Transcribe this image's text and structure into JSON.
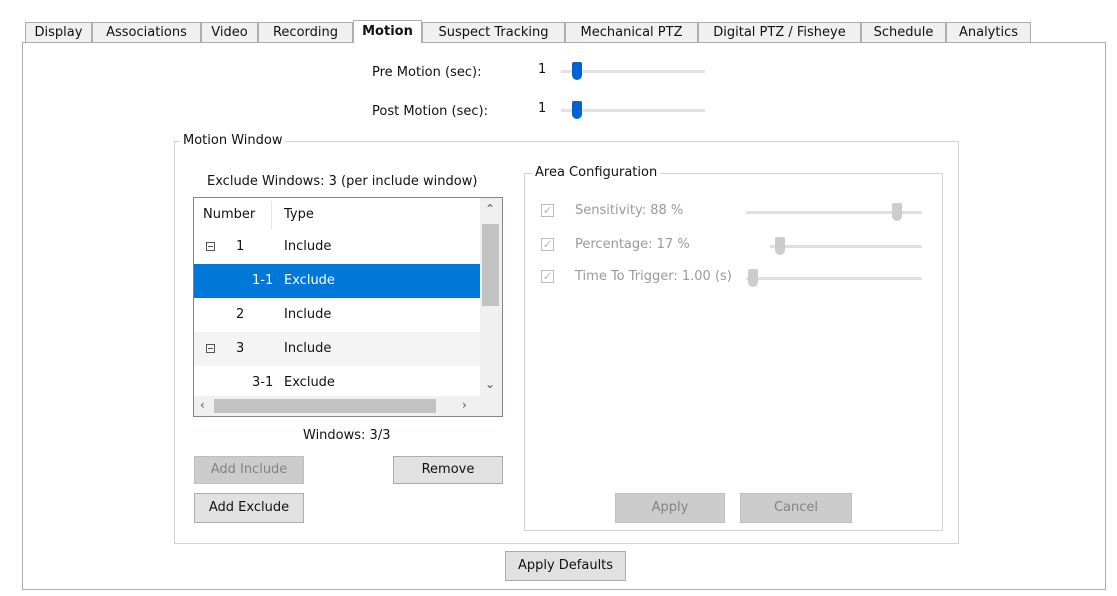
{
  "tabs": [
    {
      "label": "Display",
      "active": false
    },
    {
      "label": "Associations",
      "active": false
    },
    {
      "label": "Video",
      "active": false
    },
    {
      "label": "Recording",
      "active": false
    },
    {
      "label": "Motion",
      "active": true
    },
    {
      "label": "Suspect Tracking",
      "active": false
    },
    {
      "label": "Mechanical PTZ",
      "active": false
    },
    {
      "label": "Digital PTZ / Fisheye",
      "active": false
    },
    {
      "label": "Schedule",
      "active": false
    },
    {
      "label": "Analytics",
      "active": false
    }
  ],
  "pre_motion": {
    "label": "Pre Motion (sec):",
    "value": "1"
  },
  "post_motion": {
    "label": "Post Motion (sec):",
    "value": "1"
  },
  "motion_window": {
    "title": "Motion Window",
    "exclude_windows_text": "Exclude Windows: 3 (per include window)",
    "columns": {
      "number": "Number",
      "type": "Type"
    },
    "rows": [
      {
        "number": "1",
        "type": "Include",
        "expander": true,
        "selected": false
      },
      {
        "number": "1-1",
        "type": "Exclude",
        "expander": false,
        "selected": true
      },
      {
        "number": "2",
        "type": "Include",
        "expander": false,
        "selected": false
      },
      {
        "number": "3",
        "type": "Include",
        "expander": true,
        "selected": false
      },
      {
        "number": "3-1",
        "type": "Exclude",
        "expander": false,
        "selected": false
      }
    ],
    "windows_count": "Windows: 3/3",
    "add_include_label": "Add Include",
    "remove_label": "Remove",
    "add_exclude_label": "Add Exclude"
  },
  "area_configuration": {
    "title": "Area Configuration",
    "sensitivity": {
      "label": "Sensitivity: 88 %",
      "checked": true,
      "value": 0.88
    },
    "percentage": {
      "label": "Percentage: 17 %",
      "checked": true,
      "value": 0.17
    },
    "time_to_trigger": {
      "label": "Time To Trigger: 1.00 (s)",
      "checked": true,
      "value": 0.0
    },
    "apply_label": "Apply",
    "cancel_label": "Cancel"
  },
  "apply_defaults_label": "Apply Defaults",
  "colors": {
    "accent": "#0078d7",
    "slider_thumb": "#0063d1",
    "disabled": "#cccccc"
  }
}
